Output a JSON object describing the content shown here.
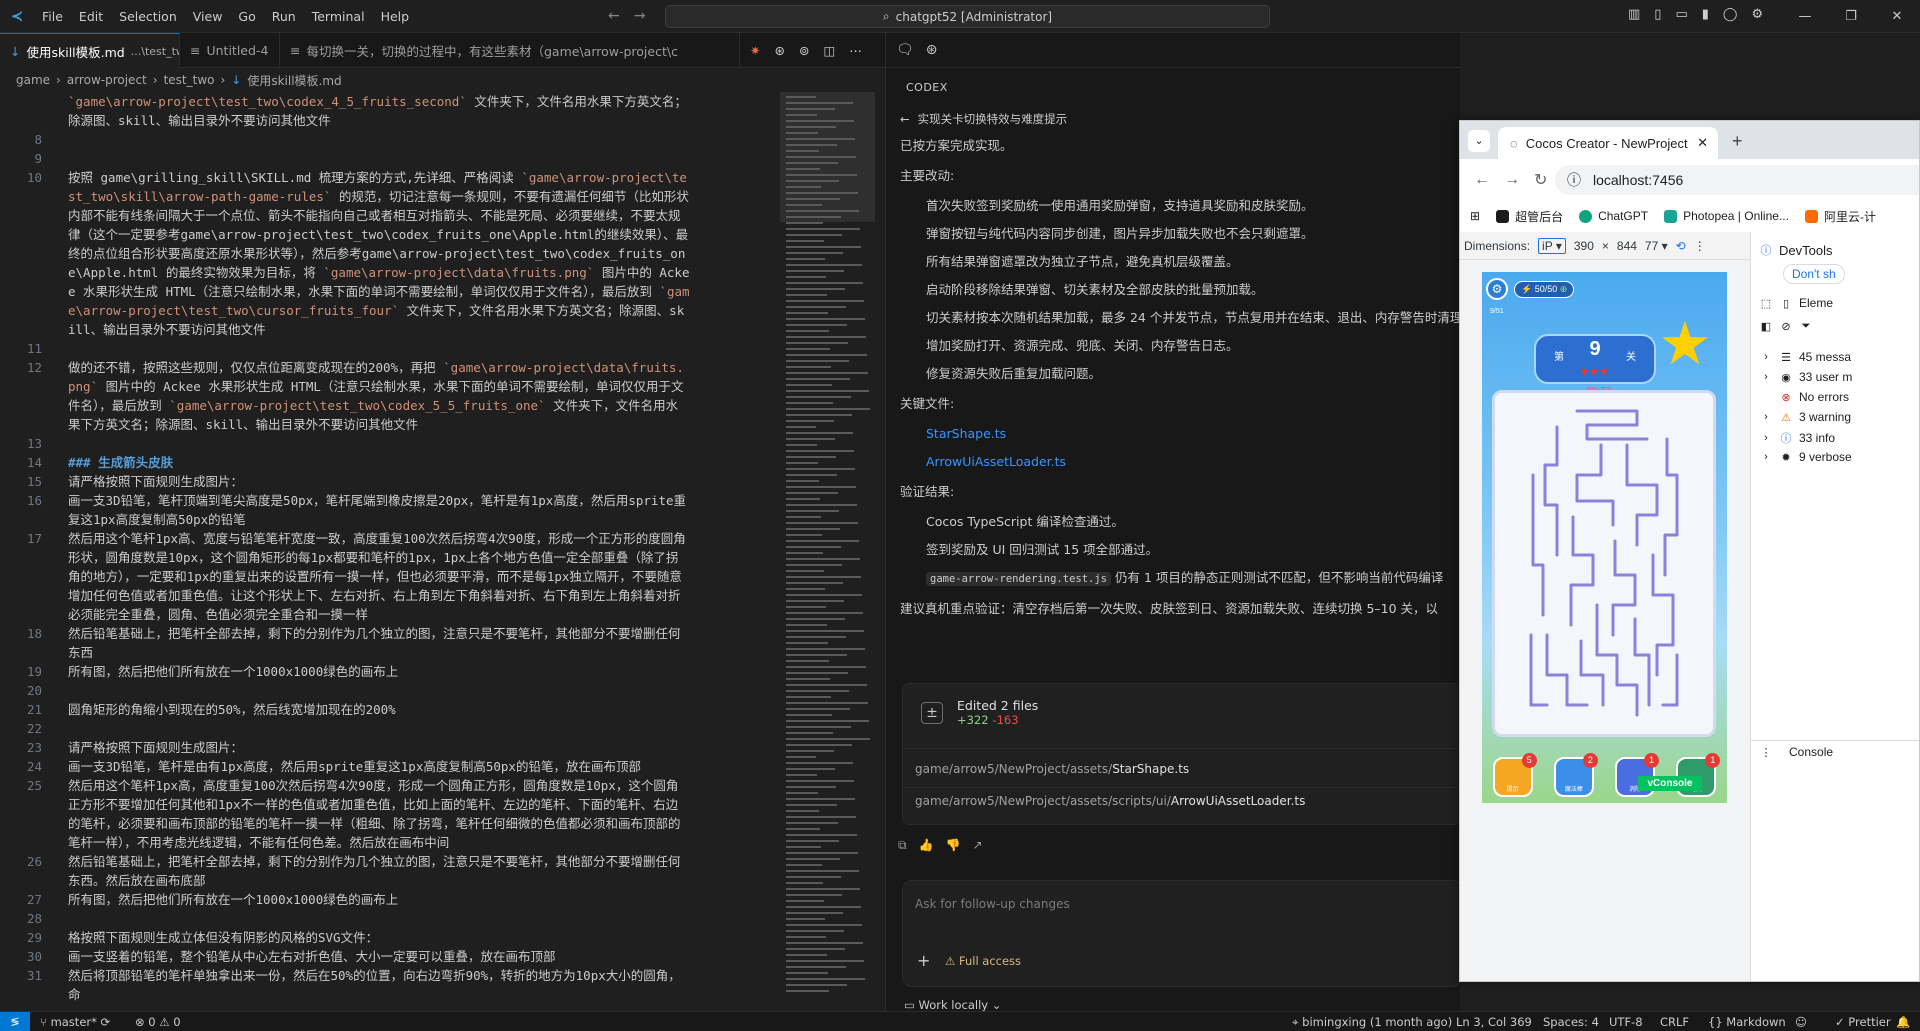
{
  "titlebar": {
    "menu": [
      "File",
      "Edit",
      "Selection",
      "View",
      "Go",
      "Run",
      "Terminal",
      "Help"
    ],
    "command_center": "chatgpt52 [Administrator]"
  },
  "tabs": [
    {
      "label": "使用skill模板.md",
      "suffix": "...\\test_two",
      "active": true
    },
    {
      "label": "Untitled-4",
      "active": false
    },
    {
      "label": "每切换一关，切换的过程中，有这些素材（game\\arrow-project\\c",
      "active": false
    }
  ],
  "breadcrumb": [
    "game",
    "arrow-project",
    "test_two",
    "使用skill模板.md"
  ],
  "editor_lines": [
    {
      "num": "",
      "html": "<span class=\"code\">`game\\arrow-project\\test_two\\codex_4_5_fruits_second`</span> 文件夹下，文件名用水果下方英文名；除源图、skill、输出目录外不要访问其他文件"
    },
    {
      "num": "8",
      "html": ""
    },
    {
      "num": "9",
      "html": ""
    },
    {
      "num": "10",
      "html": "按照 game\\grilling_skill\\SKILL.md 梳理方案的方式,先详细、严格阅读 <span class=\"code\">`game\\arrow-project\\test_two\\skill\\arrow-path-game-rules`</span> 的规范，切记注意每一条规则，不要有遗漏任何细节（比如形状内部不能有线条间隔大于一个点位、箭头不能指向自己或者相互对指箭头、不能是死局、必须要继续，不要太规律（这个一定要参考game\\arrow-project\\test_two\\codex_fruits_one\\Apple.html的继续效果）、最终的点位组合形状要高度还原水果形状等），然后参考game\\arrow-project\\test_two\\codex_fruits_one\\Apple.html 的最终实物效果为目标，将 <span class=\"code\">`game\\arrow-project\\data\\fruits.png`</span> 图片中的 Ackee 水果形状生成 HTML（注意只绘制水果，水果下面的单词不需要绘制，单词仅仅用于文件名），最后放到 <span class=\"code\">`game\\arrow-project\\test_two\\cursor_fruits_four`</span> 文件夹下，文件名用水果下方英文名；除源图、skill、输出目录外不要访问其他文件"
    },
    {
      "num": "11",
      "html": ""
    },
    {
      "num": "12",
      "html": "做的还不错，按照这些规则，仅仅点位距离变成现在的200%，再把 <span class=\"code\">`game\\arrow-project\\data\\fruits.png`</span> 图片中的 Ackee 水果形状生成 HTML（注意只绘制水果，水果下面的单词不需要绘制，单词仅仅用于文件名），最后放到 <span class=\"code\">`game\\arrow-project\\test_two\\codex_5_5_fruits_one`</span> 文件夹下，文件名用水果下方英文名；除源图、skill、输出目录外不要访问其他文件"
    },
    {
      "num": "13",
      "html": ""
    },
    {
      "num": "14",
      "html": "<span class=\"hd\">### 生成箭头皮肤</span>"
    },
    {
      "num": "15",
      "html": "请严格按照下面规则生成图片："
    },
    {
      "num": "16",
      "html": "画一支3D铅笔，笔杆顶端到笔尖高度是50px，笔杆尾端到橡皮擦是20px，笔杆是有1px高度，然后用sprite重复这1px高度复制高50px的铅笔"
    },
    {
      "num": "17",
      "html": "然后用这个笔杆1px高、宽度与铅笔笔杆宽度一致，高度重复100次然后拐弯4次90度，形成一个正方形的度圆角形状，圆角度数是10px，这个圆角矩形的每1px都要和笔杆的1px，1px上各个地方色值一定全部重叠（除了拐角的地方），一定要和1px的重复出来的设置所有一摸一样，但也必须要平滑，而不是每1px独立隔开，不要随意增加任何色值或者加重色值。让这个形状上下、左右对折、右上角到左下角斜着对折、右下角到左上角斜着对折必须能完全重叠，圆角、色值必须完全重合和一摸一样"
    },
    {
      "num": "18",
      "html": "然后铅笔基础上，把笔杆全部去掉，剩下的分别作为几个独立的图，注意只是不要笔杆，其他部分不要增删任何东西"
    },
    {
      "num": "19",
      "html": "所有图，然后把他们所有放在一个1000x1000绿色的画布上"
    },
    {
      "num": "20",
      "html": ""
    },
    {
      "num": "21",
      "html": "圆角矩形的角缩小到现在的50%，然后线宽增加现在的200%"
    },
    {
      "num": "22",
      "html": ""
    },
    {
      "num": "23",
      "html": "请严格按照下面规则生成图片："
    },
    {
      "num": "24",
      "html": "画一支3D铅笔，笔杆是由有1px高度，然后用sprite重复这1px高度复制高50px的铅笔，放在画布顶部"
    },
    {
      "num": "25",
      "html": "然后用这个笔杆1px高，高度重复100次然后拐弯4次90度，形成一个圆角正方形，圆角度数是10px，这个圆角正方形不要增加任何其他和1px不一样的色值或者加重色值，比如上面的笔杆、左边的笔杆、下面的笔杆、右边的笔杆，必须要和画布顶部的铅笔的笔杆一摸一样（粗细、除了拐弯，笔杆任何细微的色值都必须和画布顶部的笔杆一样），不用考虑光线逻辑，不能有任何色差。然后放在画布中间"
    },
    {
      "num": "26",
      "html": "然后铅笔基础上，把笔杆全部去掉，剩下的分别作为几个独立的图，注意只是不要笔杆，其他部分不要增删任何东西。然后放在画布底部"
    },
    {
      "num": "27",
      "html": "所有图，然后把他们所有放在一个1000x1000绿色的画布上"
    },
    {
      "num": "28",
      "html": ""
    },
    {
      "num": "29",
      "html": "格按照下面规则生成立体但没有阴影的风格的SVG文件："
    },
    {
      "num": "30",
      "html": "画一支竖着的铅笔，整个铅笔从中心左右对折色值、大小一定要可以重叠，放在画布顶部"
    },
    {
      "num": "31",
      "html": "然后将顶部铅笔的笔杆单独拿出来一份，然后在50%的位置，向右边弯折90%，转折的地方为10px大小的圆角，命"
    }
  ],
  "codex": {
    "header_label": "CODEX",
    "thread_title": "实现关卡切换特效与难度提示",
    "intro": "已按方案完成实现。",
    "changes_title": "主要改动:",
    "changes": [
      "首次失败签到奖励统一使用通用奖励弹窗，支持道具奖励和皮肤奖励。",
      "弹窗按钮与纯代码内容同步创建，图片异步加载失败也不会只剩遮罩。",
      "所有结果弹窗遮罩改为独立子节点，避免真机层级覆盖。",
      "启动阶段移除结果弹窗、切关素材及全部皮肤的批量预加载。",
      "切关素材按本次随机结果加载，最多 24 个并发节点，节点复用并在结束、退出、内存警告时清理",
      "增加奖励打开、资源完成、兜底、关闭、内存警告日志。",
      "修复资源失败后重复加载问题。"
    ],
    "files_title": "关键文件:",
    "files": [
      "StarShape.ts",
      "ArrowUiAssetLoader.ts"
    ],
    "verify_title": "验证结果:",
    "verify": [
      "Cocos TypeScript 编译检查通过。",
      "签到奖励及 UI 回归测试 15 项全部通过。"
    ],
    "verify_code": "game-arrow-rendering.test.js",
    "verify_code_rest": "仍有 1 项目的静态正则测试不匹配，但不影响当前代码编译",
    "suggest": "建议真机重点验证：清空存档后第一次失败、皮肤签到日、资源加载失败、连续切换 5–10 关，以",
    "edited_title": "Edited 2 files",
    "added": "+322",
    "removed": "-163",
    "edited_files": [
      {
        "dir": "game/arrow5/NewProject/assets/",
        "name": "StarShape.ts"
      },
      {
        "dir": "game/arrow5/NewProject/assets/scripts/ui/",
        "name": "ArrowUiAssetLoader.ts"
      }
    ],
    "input_placeholder": "Ask for follow-up changes",
    "full_access": "Full access",
    "work_locally": "Work locally"
  },
  "browser": {
    "tab_title": "Cocos Creator - NewProject",
    "url": "localhost:7456",
    "bookmarks": [
      "超管后台",
      "ChatGPT",
      "Photopea | Online...",
      "阿里云-计"
    ],
    "dimensions_label": "Dimensions:",
    "device": "iP",
    "width": "390",
    "height": "844",
    "zoom": "77",
    "devtools_title": "DevTools",
    "devtools_dont": "Don't sh",
    "devtools_tab": "Eleme",
    "console_rows": [
      "45 messa",
      "33 user m",
      "No errors",
      "3 warning",
      "33 info",
      "9 verbose"
    ],
    "console_label": "Console",
    "game": {
      "energy": "50/50",
      "progress": "9/51",
      "level_prefix": "第",
      "level": "9",
      "level_suffix": "关",
      "timer": "00:53",
      "powerups": [
        {
          "badge": "5",
          "name": "提示",
          "color": "#f5a623"
        },
        {
          "badge": "2",
          "name": "魔法棒",
          "color": "#3b8fe8"
        },
        {
          "badge": "1",
          "name": "消除",
          "color": "#4a6ee0"
        },
        {
          "badge": "1",
          "name": "时间",
          "color": "#2f9a6a"
        }
      ],
      "vconsole": "vConsole"
    }
  },
  "statusbar": {
    "branch": "master*",
    "problems": "⊗ 0 ⚠ 0",
    "blame": "bimingxing (1 month ago)",
    "position": "Ln 3, Col 369",
    "spaces": "Spaces: 4",
    "encoding": "UTF-8",
    "eol": "CRLF",
    "language": "Markdown",
    "prettier": "✓ Prettier"
  }
}
